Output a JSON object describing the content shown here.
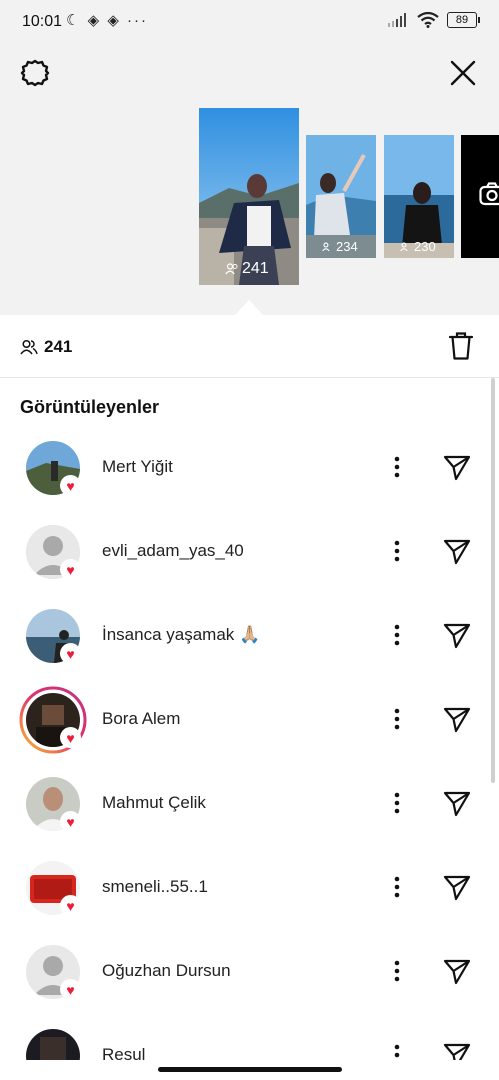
{
  "status_bar": {
    "time": "10:01",
    "left_icons": "☾ ◈ ◈ ···",
    "battery": "89"
  },
  "stories": [
    {
      "count": "241",
      "selected": true
    },
    {
      "count": "234",
      "selected": false
    },
    {
      "count": "230",
      "selected": false
    }
  ],
  "viewer_summary": {
    "count": "241"
  },
  "section_title": "Görüntüleyenler",
  "viewers": [
    {
      "name": "Mert Yiğit",
      "avatar": "photo-landscape"
    },
    {
      "name": "evli_adam_yas_40",
      "avatar": "placeholder"
    },
    {
      "name": "İnsanca yaşamak 🙏🏼",
      "avatar": "photo-sea"
    },
    {
      "name": "Bora Alem",
      "avatar": "photo-room",
      "story_ring": true
    },
    {
      "name": "Mahmut Çelik",
      "avatar": "photo-person"
    },
    {
      "name": "smeneli..55..1",
      "avatar": "photo-red-case"
    },
    {
      "name": "Oğuzhan Dursun",
      "avatar": "placeholder"
    },
    {
      "name": "Resul",
      "avatar": "photo-night"
    }
  ],
  "colors": {
    "heart": "#ed1d3a",
    "background_top": "#f2f2f2",
    "story_ring": "#d6249f"
  }
}
